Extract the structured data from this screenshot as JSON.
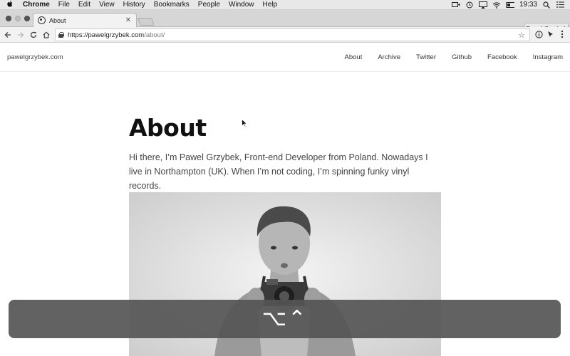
{
  "menubar": {
    "app": "Chrome",
    "items": [
      "File",
      "Edit",
      "View",
      "History",
      "Bookmarks",
      "People",
      "Window",
      "Help"
    ],
    "time": "19:33"
  },
  "browser": {
    "tab_title": "About",
    "profile_name": "Pawel Grzybek",
    "url_base": "https://pawelgrzybek.com",
    "url_path": "/about/"
  },
  "site": {
    "brand": "pawelgrzybek.com",
    "nav": [
      "About",
      "Archive",
      "Twitter",
      "Github",
      "Facebook",
      "Instagram"
    ],
    "page_title": "About",
    "intro": "Hi there, I’m Pawel Grzybek, Front-end Developer from Poland. Nowadays I live in Northampton (UK). When I’m not coding, I’m spinning funky vinyl records."
  },
  "hud": {
    "symbol": "⌥⌃"
  },
  "icons": {
    "apple": "apple-icon",
    "back": "back-arrow-icon",
    "forward": "forward-arrow-icon",
    "reload": "reload-icon",
    "home": "home-icon",
    "lock": "lock-icon",
    "bookmark": "star-icon"
  }
}
